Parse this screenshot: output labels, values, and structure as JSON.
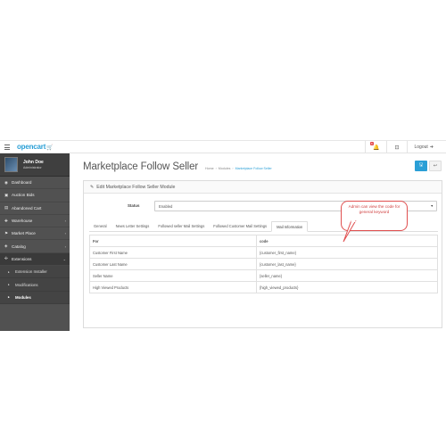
{
  "header": {
    "logo": "opencart",
    "notification_count": "6",
    "logout_label": "Logout"
  },
  "sidebar": {
    "profile": {
      "name": "John Doe",
      "role": "Administrator"
    },
    "items": [
      {
        "label": "Dashboard",
        "icon": "dashboard-icon",
        "arrow": ""
      },
      {
        "label": "Auction Bids",
        "icon": "auction-icon",
        "arrow": ""
      },
      {
        "label": "Abandoned Cart",
        "icon": "cart-icon",
        "arrow": ""
      },
      {
        "label": "Warehouse",
        "icon": "warehouse-icon",
        "arrow": "›"
      },
      {
        "label": "Market Place",
        "icon": "marketplace-icon",
        "arrow": "›"
      },
      {
        "label": "Catalog",
        "icon": "catalog-icon",
        "arrow": "›"
      },
      {
        "label": "Extensions",
        "icon": "puzzle-icon",
        "arrow": "⌄"
      }
    ],
    "subitems": [
      {
        "label": "Extension Installer"
      },
      {
        "label": "Modifications"
      },
      {
        "label": "Modules"
      }
    ]
  },
  "page": {
    "title": "Marketplace Follow Seller",
    "breadcrumbs": [
      "Home",
      "Modules",
      "Marketplace Follow Seller"
    ]
  },
  "panel": {
    "heading": "Edit Marketplace Follow Seller Module",
    "status_label": "Status",
    "status_value": "Enabled",
    "tabs": [
      "General",
      "News Letter Settings",
      "Followed seller Mail Settings",
      "Followed Customer Mail Settings",
      "Mail Information"
    ],
    "active_tab": 4,
    "table": {
      "headers": [
        "For",
        "code"
      ],
      "rows": [
        [
          "Customer First Name",
          "{customer_first_name}"
        ],
        [
          "Customer Last Name",
          "{customer_last_name}"
        ],
        [
          "Seller Name",
          "{seller_name}"
        ],
        [
          "High Viewed Products",
          "{high_viewed_products}"
        ]
      ]
    }
  },
  "callout": {
    "text": "Admin can view the code for general keyword"
  },
  "colors": {
    "accent": "#2a9fd6",
    "sidebar": "#515151",
    "callout": "#e05050"
  }
}
